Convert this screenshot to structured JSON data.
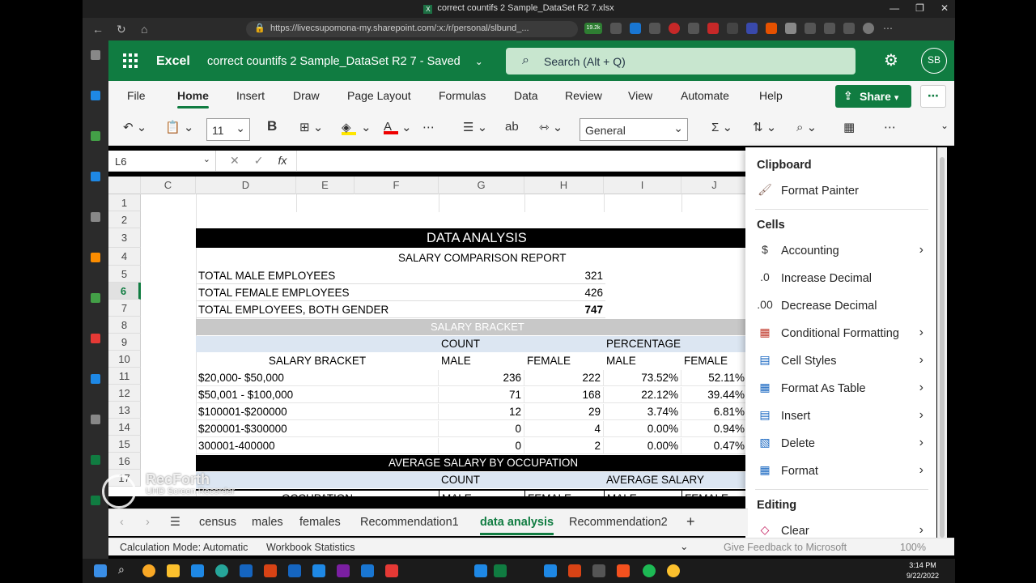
{
  "browser": {
    "window_title": "correct countifs 2 Sample_DataSet R2 7.xlsx",
    "url": "https://livecsupomona-my.sharepoint.com/:x:/r/personal/slbund_...",
    "badge_count": "19.2k"
  },
  "header": {
    "app_name": "Excel",
    "doc_title": "correct countifs 2 Sample_DataSet R2 7  -  Saved",
    "search_placeholder": "Search (Alt + Q)",
    "avatar_initials": "SB"
  },
  "ribbon": {
    "tabs": [
      "File",
      "Home",
      "Insert",
      "Draw",
      "Page Layout",
      "Formulas",
      "Data",
      "Review",
      "View",
      "Automate",
      "Help"
    ],
    "active_tab": "Home",
    "share_label": "Share",
    "font_size": "11",
    "number_format": "General",
    "bold_label": "B"
  },
  "formula_bar": {
    "name_box": "L6",
    "fx": "fx"
  },
  "grid": {
    "columns": [
      "C",
      "D",
      "E",
      "F",
      "G",
      "H",
      "I",
      "J"
    ],
    "rows": [
      "1",
      "2",
      "3",
      "4",
      "5",
      "6",
      "7",
      "8",
      "9",
      "10",
      "11",
      "12",
      "13",
      "14",
      "15",
      "16",
      "17"
    ],
    "title": "DATA ANALYSIS",
    "subtitle": "SALARY COMPARISON REPORT",
    "summary": [
      {
        "label": "TOTAL MALE EMPLOYEES",
        "value": "321"
      },
      {
        "label": "TOTAL FEMALE EMPLOYEES",
        "value": "426"
      },
      {
        "label": "TOTAL EMPLOYEES, BOTH GENDER",
        "value": "747"
      }
    ],
    "salary_bracket_header": "SALARY BRACKET",
    "count_header": "COUNT",
    "percentage_header": "PERCENTAGE",
    "subheaders": [
      "SALARY BRACKET",
      "MALE",
      "FEMALE",
      "MALE",
      "FEMALE"
    ],
    "brackets": [
      {
        "bracket": "$20,000- $50,000",
        "male": "236",
        "female": "222",
        "male_pct": "73.52%",
        "female_pct": "52.11%"
      },
      {
        "bracket": "$50,001 - $100,000",
        "male": "71",
        "female": "168",
        "male_pct": "22.12%",
        "female_pct": "39.44%"
      },
      {
        "bracket": "$100001-$200000",
        "male": "12",
        "female": "29",
        "male_pct": "3.74%",
        "female_pct": "6.81%"
      },
      {
        "bracket": "$200001-$300000",
        "male": "0",
        "female": "4",
        "male_pct": "0.00%",
        "female_pct": "0.94%"
      },
      {
        "bracket": "300001-400000",
        "male": "0",
        "female": "2",
        "male_pct": "0.00%",
        "female_pct": "0.47%"
      }
    ],
    "avg_title": "AVERAGE SALARY BY OCCUPATION",
    "avg_count_header": "COUNT",
    "avg_salary_header": "AVERAGE SALARY",
    "avg_subheaders": [
      "OCCUPATION",
      "MALE",
      "FEMALE",
      "MALE",
      "FEMALE"
    ]
  },
  "panel": {
    "sections": [
      {
        "title": "Clipboard",
        "items": [
          {
            "label": "Format Painter",
            "icon": "format-painter-icon",
            "submenu": false
          }
        ]
      },
      {
        "title": "Cells",
        "items": [
          {
            "label": "Accounting",
            "icon": "dollar-icon",
            "submenu": true
          },
          {
            "label": "Increase Decimal",
            "icon": "increase-decimal-icon",
            "submenu": false
          },
          {
            "label": "Decrease Decimal",
            "icon": "decrease-decimal-icon",
            "submenu": false
          },
          {
            "label": "Conditional Formatting",
            "icon": "conditional-formatting-icon",
            "submenu": true
          },
          {
            "label": "Cell Styles",
            "icon": "cell-styles-icon",
            "submenu": true
          },
          {
            "label": "Format As Table",
            "icon": "format-as-table-icon",
            "submenu": true
          },
          {
            "label": "Insert",
            "icon": "insert-cells-icon",
            "submenu": true
          },
          {
            "label": "Delete",
            "icon": "delete-cells-icon",
            "submenu": true
          },
          {
            "label": "Format",
            "icon": "format-cells-icon",
            "submenu": true
          }
        ]
      },
      {
        "title": "Editing",
        "items": [
          {
            "label": "Clear",
            "icon": "eraser-icon",
            "submenu": true
          }
        ]
      }
    ]
  },
  "sheets": {
    "tabs": [
      "census",
      "males",
      "females",
      "Recommendation1",
      "data analysis",
      "Recommendation2"
    ],
    "active": "data analysis",
    "add_label": "+"
  },
  "status": {
    "calc_mode": "Calculation Mode: Automatic",
    "workbook_stats": "Workbook Statistics",
    "feedback": "Give Feedback to Microsoft",
    "zoom": "100%"
  },
  "watermark": {
    "brand": "RecForth",
    "sub": "UHD Screen Recorder"
  },
  "taskbar": {
    "time": "3:14 PM",
    "date": "9/22/2022"
  },
  "colors": {
    "excel_green": "#107c41",
    "header_black": "#000000",
    "bracket_gray": "#c8c8c8",
    "light_blue": "#dce6f2"
  }
}
